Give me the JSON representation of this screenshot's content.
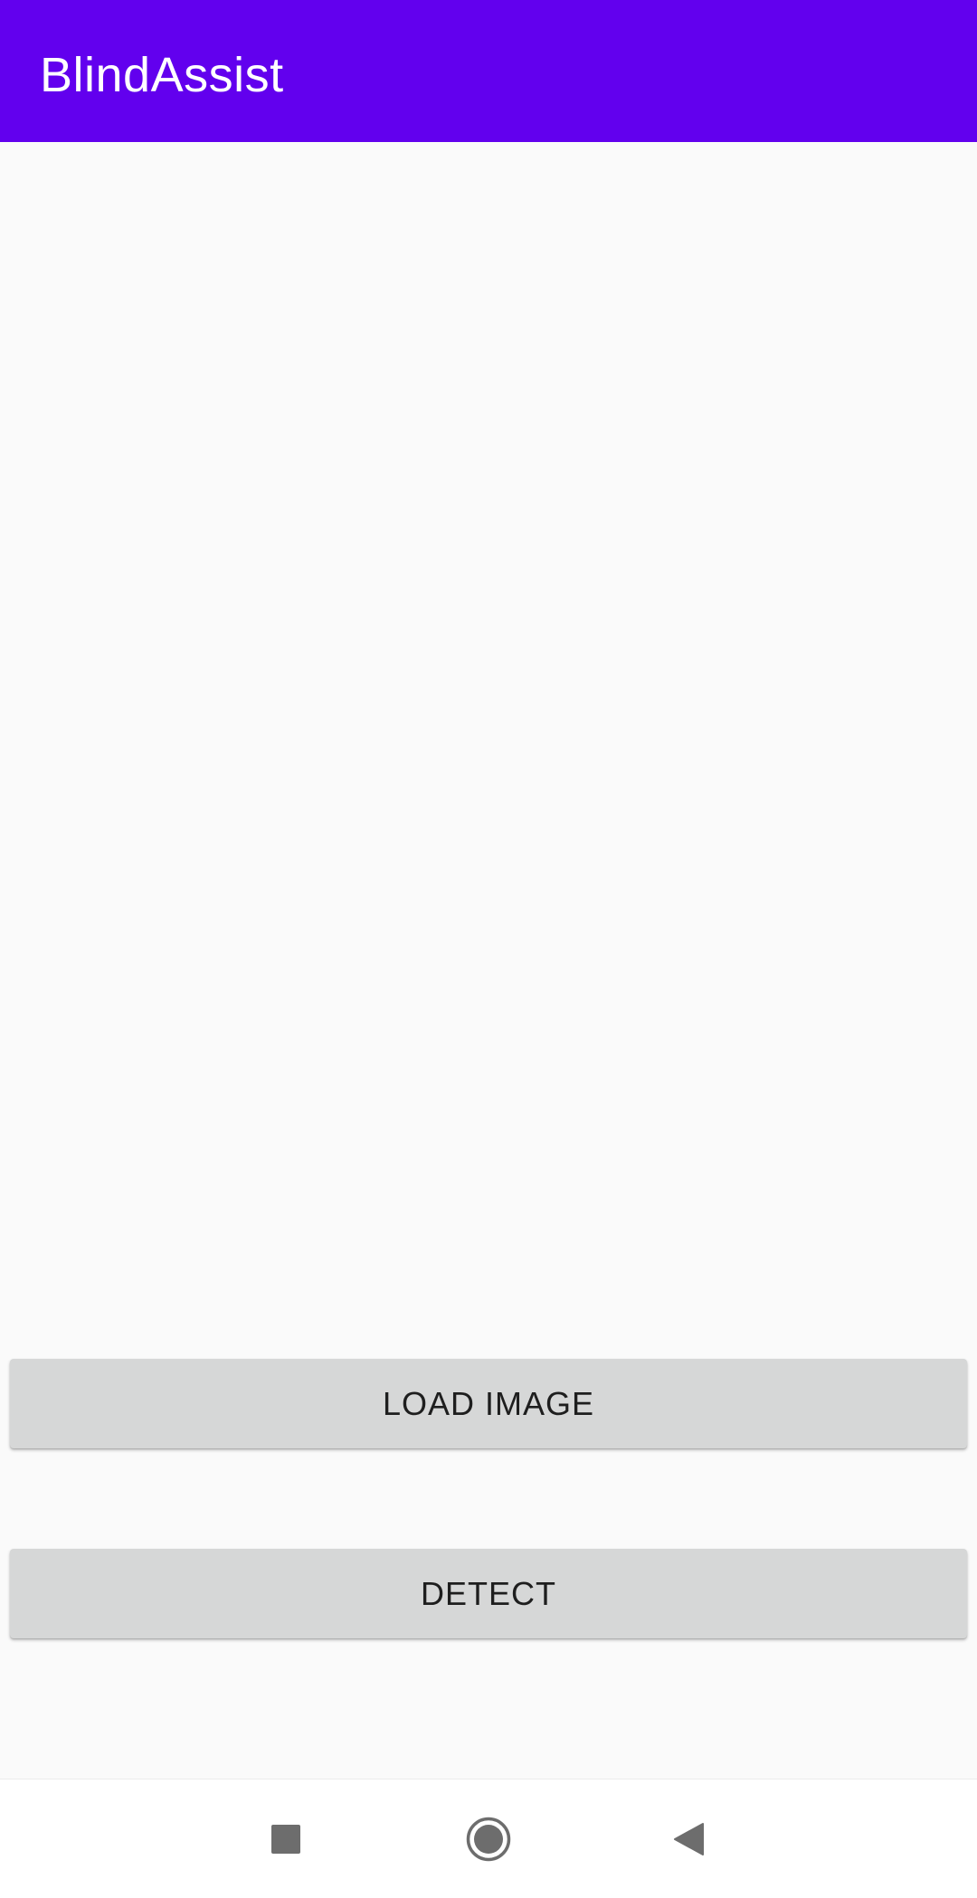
{
  "app_bar": {
    "title": "BlindAssist",
    "color": "#6200ee"
  },
  "actions": {
    "load_image_label": "LOAD IMAGE",
    "detect_label": "DETECT"
  },
  "nav_bar": {
    "icons": [
      "recents-icon",
      "home-icon",
      "back-icon"
    ],
    "icon_color": "#6d6d6d"
  }
}
